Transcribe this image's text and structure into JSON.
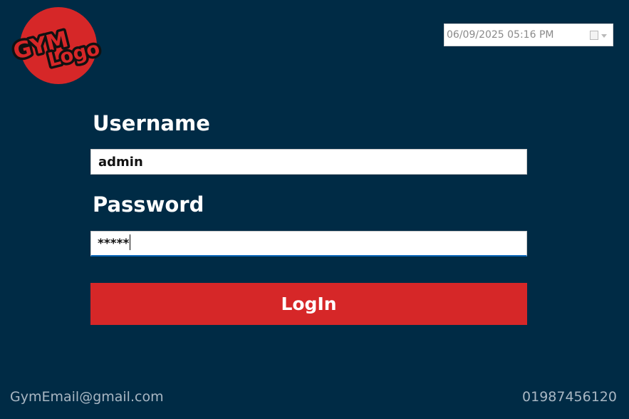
{
  "logo": {
    "line1": "GYM",
    "line2": "Logo"
  },
  "date_picker": {
    "value": "06/09/2025 05:16 PM"
  },
  "form": {
    "username_label": "Username",
    "username_value": "admin",
    "password_label": "Password",
    "password_value": "*****",
    "login_label": "LogIn"
  },
  "footer": {
    "email": "GymEmail@gmail.com",
    "phone": "01987456120"
  },
  "colors": {
    "background": "#002b45",
    "accent": "#d62728",
    "input_bg": "#ffffff",
    "focus_border": "#0a66b8",
    "footer_text": "#a9b7c3"
  },
  "icons": {
    "date_button": "calendar-icon",
    "dropdown": "chevron-down-icon"
  }
}
